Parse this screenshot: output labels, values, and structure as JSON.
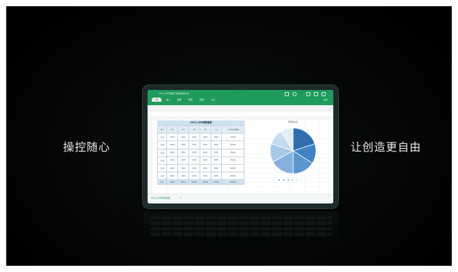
{
  "taglines": {
    "left": "操控随心",
    "right": "让创造更自由"
  },
  "spreadsheet": {
    "document_title": "2021上半年各部门销售额统计表",
    "tabs": [
      "开始",
      "插入",
      "数据",
      "审阅",
      "视图",
      "公式"
    ],
    "share_text": "协作",
    "table_title": "2021上半年销售数据",
    "header_row": [
      "部门",
      "1月",
      "2月",
      "3月",
      "4月",
      "5月",
      "上半年总销售额"
    ],
    "rows": [
      [
        "产品1",
        "",
        "",
        "",
        "",
        "",
        ""
      ],
      [
        "产品2",
        "",
        "",
        "",
        "",
        "",
        ""
      ],
      [
        "产品3",
        "",
        "",
        "",
        "",
        "",
        ""
      ],
      [
        "产品4",
        "",
        "",
        "",
        "",
        "",
        ""
      ],
      [
        "产品5",
        "",
        "",
        "",
        "",
        "",
        ""
      ],
      [
        "产品6",
        "",
        "",
        "",
        "",
        "",
        ""
      ],
      [
        "总计",
        "",
        "",
        "",
        "",
        "",
        ""
      ]
    ],
    "chart_title": "销售额占比",
    "sheet_tab": "2021上半年销售数据",
    "add_sheet": "+"
  },
  "pie_colors": [
    "#2f6fb0",
    "#3f83c4",
    "#5a97d1",
    "#86b1dc",
    "#a9c7e6",
    "#c7dbef",
    "#e3edf7"
  ],
  "pie_shares": [
    0.2,
    0.14,
    0.16,
    0.17,
    0.13,
    0.11,
    0.09
  ],
  "colors": {
    "title_bar": "#1f9b5c",
    "background": "#000000",
    "text": "#e8e8e8"
  }
}
